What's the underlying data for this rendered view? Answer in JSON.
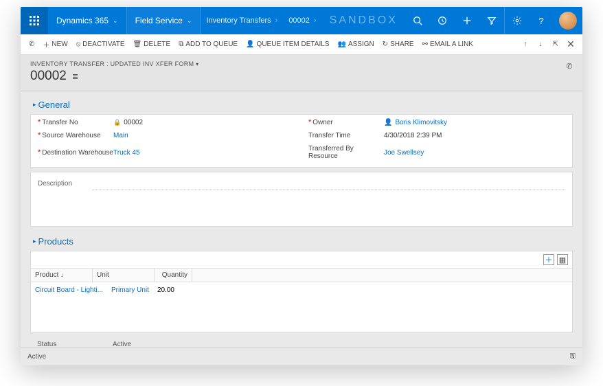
{
  "topnav": {
    "brand": "Dynamics 365",
    "app": "Field Service",
    "crumb1": "Inventory Transfers",
    "crumb2": "00002",
    "sandbox": "SANDBOX"
  },
  "commands": {
    "new": "NEW",
    "deactivate": "DEACTIVATE",
    "delete": "DELETE",
    "addToQueue": "ADD TO QUEUE",
    "queueItemDetails": "QUEUE ITEM DETAILS",
    "assign": "ASSIGN",
    "share": "SHARE",
    "emailLink": "EMAIL A LINK"
  },
  "record": {
    "formLabel": "INVENTORY TRANSFER : UPDATED INV XFER FORM",
    "title": "00002"
  },
  "sections": {
    "general": "General",
    "products": "Products"
  },
  "fields": {
    "transferNo": {
      "label": "Transfer No",
      "value": "00002"
    },
    "sourceWarehouse": {
      "label": "Source Warehouse",
      "value": "Main"
    },
    "destWarehouse": {
      "label": "Destination Warehouse",
      "value": "Truck 45"
    },
    "owner": {
      "label": "Owner",
      "value": "Boris Klimovitsky"
    },
    "transferTime": {
      "label": "Transfer Time",
      "value": "4/30/2018  2:39 PM"
    },
    "transferredBy": {
      "label": "Transferred By Resource",
      "value": "Joe Swellsey"
    },
    "description": {
      "label": "Description"
    },
    "status": {
      "label": "Status",
      "value": "Active"
    }
  },
  "grid": {
    "cols": {
      "product": "Product",
      "unit": "Unit",
      "quantity": "Quantity"
    },
    "rows": [
      {
        "product": "Circuit Board - Lighti...",
        "unit": "Primary Unit",
        "quantity": "20.00"
      }
    ]
  },
  "footer": {
    "state": "Active"
  }
}
